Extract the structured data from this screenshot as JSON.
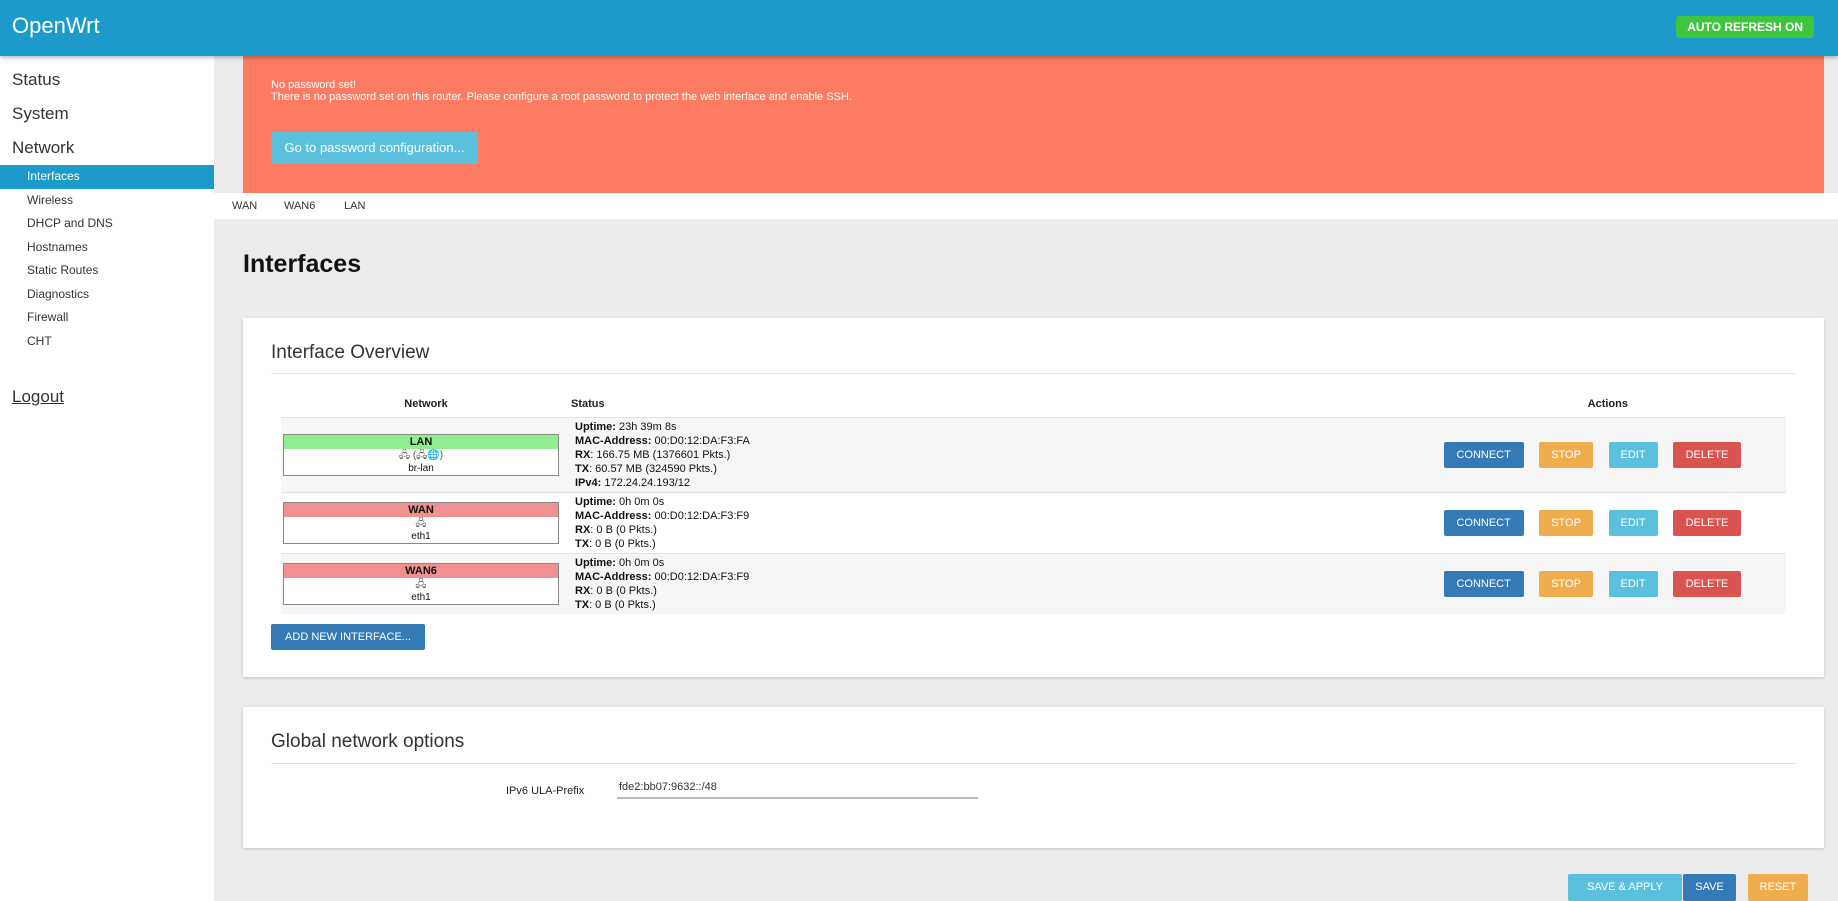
{
  "header": {
    "brand": "OpenWrt",
    "auto_refresh": "AUTO REFRESH ON"
  },
  "sidebar": {
    "top_items": [
      "Status",
      "System",
      "Network"
    ],
    "network_items": [
      "Interfaces",
      "Wireless",
      "DHCP and DNS",
      "Hostnames",
      "Static Routes",
      "Diagnostics",
      "Firewall",
      "CHT"
    ],
    "logout": "Logout"
  },
  "alert": {
    "title": "No password set!",
    "text": "There is no password set on this router. Please configure a root password to protect the web interface and enable SSH.",
    "button": "Go to password configuration..."
  },
  "tabs": [
    "WAN",
    "WAN6",
    "LAN"
  ],
  "page_title": "Interfaces",
  "overview": {
    "title": "Interface Overview",
    "columns": {
      "network": "Network",
      "status": "Status",
      "actions": "Actions"
    },
    "rows": [
      {
        "name": "LAN",
        "name_color": "#90ee90",
        "icons": "🖧 (🖧🌐)",
        "device": "br-lan",
        "status": [
          {
            "k": "Uptime:",
            "v": " 23h 39m 8s"
          },
          {
            "k": "MAC-Address:",
            "v": " 00:D0:12:DA:F3:FA"
          },
          {
            "k": "RX",
            "v": ": 166.75 MB (1376601 Pkts.)"
          },
          {
            "k": "TX",
            "v": ": 60.57 MB (324590 Pkts.)"
          },
          {
            "k": "IPv4:",
            "v": " 172.24.24.193/12"
          }
        ]
      },
      {
        "name": "WAN",
        "name_color": "#f09090",
        "icons": "🖧",
        "device": "eth1",
        "status": [
          {
            "k": "Uptime:",
            "v": " 0h 0m 0s"
          },
          {
            "k": "MAC-Address:",
            "v": " 00:D0:12:DA:F3:F9"
          },
          {
            "k": "RX",
            "v": ": 0 B (0 Pkts.)"
          },
          {
            "k": "TX",
            "v": ": 0 B (0 Pkts.)"
          }
        ]
      },
      {
        "name": "WAN6",
        "name_color": "#f09090",
        "icons": "🖧",
        "device": "eth1",
        "status": [
          {
            "k": "Uptime:",
            "v": " 0h 0m 0s"
          },
          {
            "k": "MAC-Address:",
            "v": " 00:D0:12:DA:F3:F9"
          },
          {
            "k": "RX",
            "v": ": 0 B (0 Pkts.)"
          },
          {
            "k": "TX",
            "v": ": 0 B (0 Pkts.)"
          }
        ]
      }
    ],
    "actions": {
      "connect": "CONNECT",
      "stop": "STOP",
      "edit": "EDIT",
      "delete": "DELETE"
    },
    "add_button": "ADD NEW INTERFACE..."
  },
  "global": {
    "title": "Global network options",
    "ula_label": "IPv6 ULA-Prefix",
    "ula_value": "fde2:bb07:9632::/48"
  },
  "footer": {
    "save_apply": "SAVE & APPLY",
    "save": "SAVE",
    "reset": "RESET"
  },
  "colors": {
    "header": "#1c9ac9",
    "alert": "#fd7b62",
    "primary": "#337ab7",
    "warning": "#f0ad4e",
    "info": "#5bc0de",
    "danger": "#d9534f",
    "success": "#3ec53e"
  }
}
